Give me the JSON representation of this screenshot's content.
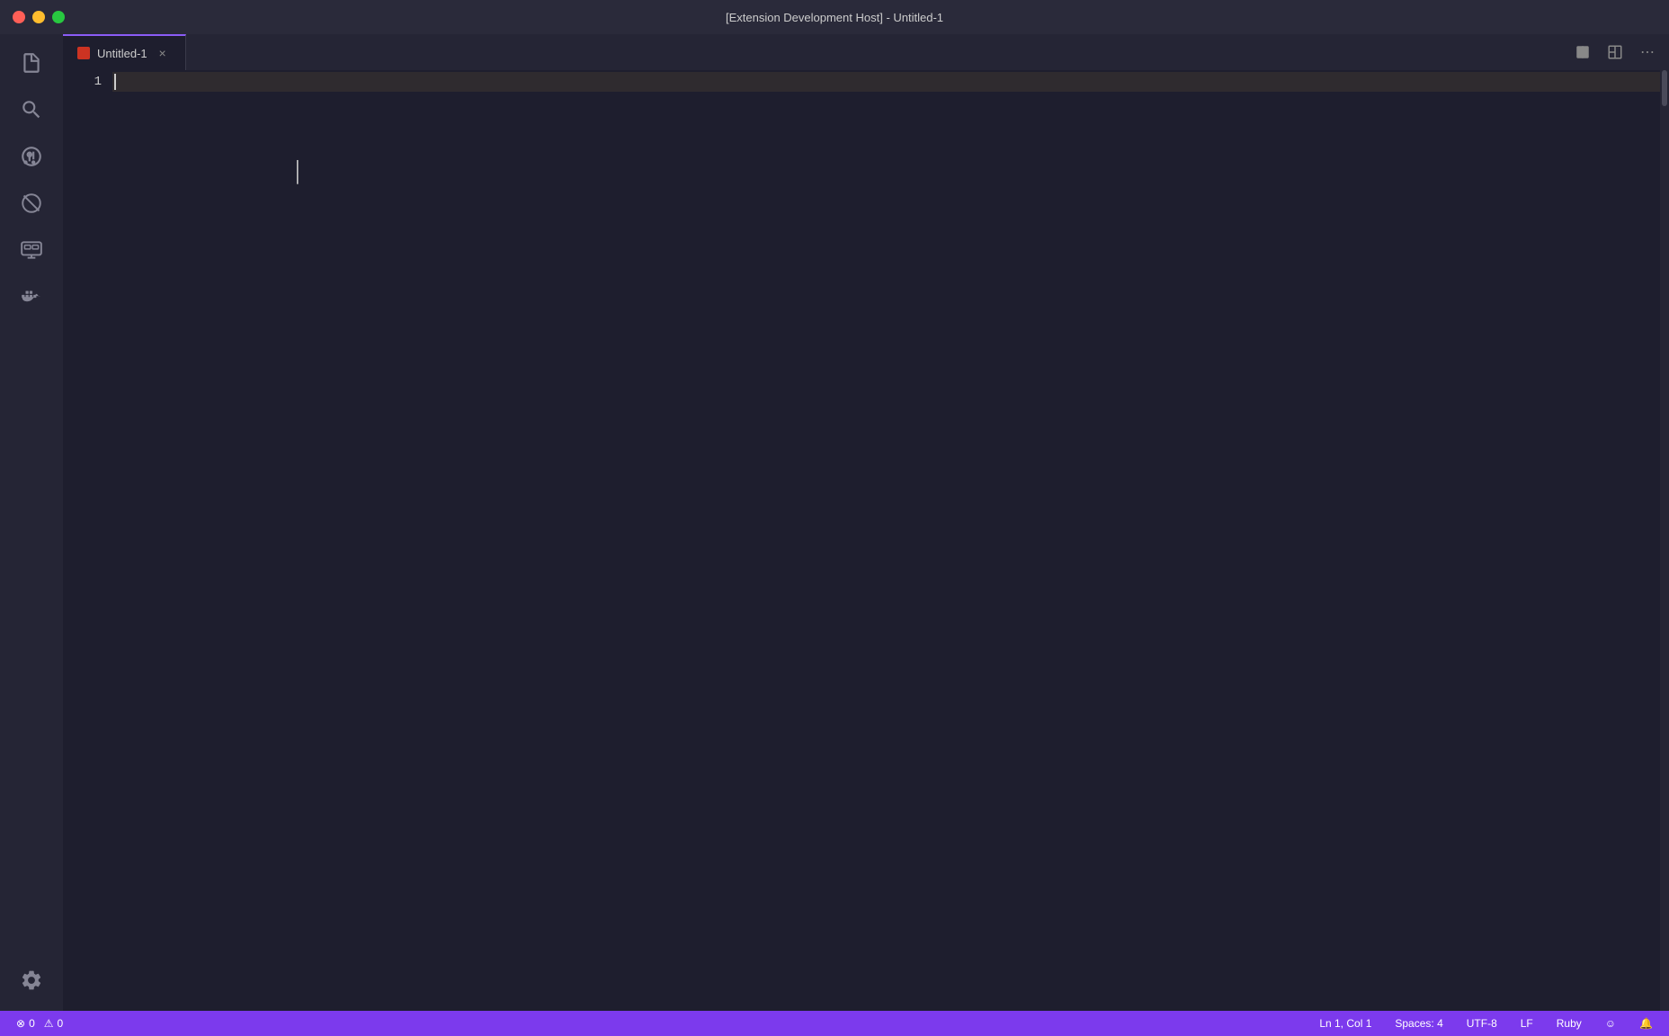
{
  "titlebar": {
    "title": "[Extension Development Host] - Untitled-1",
    "buttons": {
      "close": "close",
      "minimize": "minimize",
      "maximize": "maximize"
    }
  },
  "activitybar": {
    "items": [
      {
        "name": "explorer",
        "icon": "files",
        "active": false
      },
      {
        "name": "search",
        "icon": "search",
        "active": false
      },
      {
        "name": "source-control",
        "icon": "git",
        "active": false
      },
      {
        "name": "extensions",
        "icon": "extensions",
        "active": false
      },
      {
        "name": "remote-explorer",
        "icon": "remote",
        "active": false
      },
      {
        "name": "docker",
        "icon": "docker",
        "active": false
      }
    ],
    "bottom": [
      {
        "name": "settings",
        "icon": "gear",
        "active": false
      }
    ]
  },
  "tabbar": {
    "tabs": [
      {
        "name": "Untitled-1",
        "active": true,
        "dirty": true
      }
    ],
    "actions": {
      "split": "⊟",
      "layout": "▣",
      "more": "⋯"
    }
  },
  "editor": {
    "line_count": 1,
    "active_line": 1
  },
  "statusbar": {
    "errors": "0",
    "warnings": "0",
    "position": "Ln 1, Col 1",
    "spaces": "Spaces: 4",
    "encoding": "UTF-8",
    "line_ending": "LF",
    "language": "Ruby",
    "smiley": "☺",
    "bell": "🔔"
  }
}
